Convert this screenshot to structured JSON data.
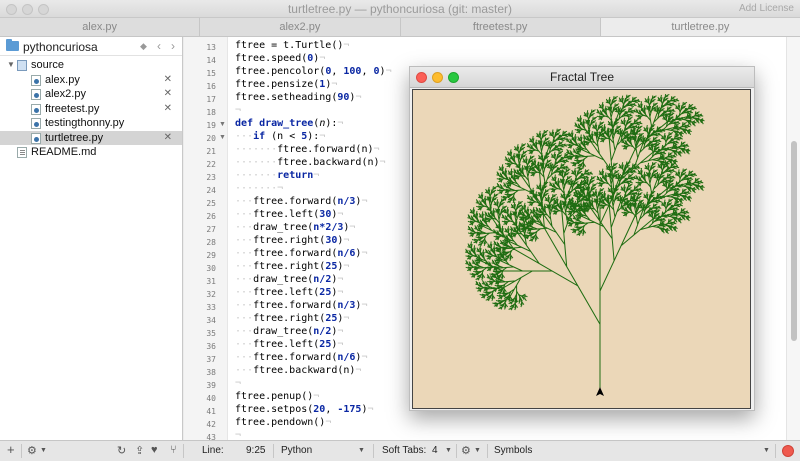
{
  "window": {
    "title": "turtletree.py — pythoncuriosa (git: master)",
    "add_license": "Add License"
  },
  "tabs": [
    {
      "label": "alex.py"
    },
    {
      "label": "alex2.py"
    },
    {
      "label": "ftreetest.py"
    },
    {
      "label": "turtletree.py"
    }
  ],
  "sidebar": {
    "project": "pythoncuriosa",
    "items": [
      {
        "label": "source"
      },
      {
        "label": "alex.py"
      },
      {
        "label": "alex2.py"
      },
      {
        "label": "ftreetest.py"
      },
      {
        "label": "testingthonny.py"
      },
      {
        "label": "turtletree.py"
      },
      {
        "label": "README.md"
      }
    ]
  },
  "editor": {
    "line_numbers": [
      "13",
      "14",
      "15",
      "16",
      "17",
      "18",
      "19",
      "20",
      "21",
      "22",
      "23",
      "24",
      "25",
      "26",
      "27",
      "28",
      "29",
      "30",
      "31",
      "32",
      "33",
      "34",
      "35",
      "36",
      "37",
      "38",
      "39",
      "40",
      "41",
      "42",
      "43",
      "44"
    ]
  },
  "turtle_window": {
    "title": "Fractal Tree"
  },
  "statusbar": {
    "line_label": "Line:",
    "position": "9:25",
    "language": "Python",
    "soft_tabs_label": "Soft Tabs:",
    "soft_tabs_value": "4",
    "symbols": "Symbols"
  },
  "colors": {
    "tree": "#1f6d12",
    "canvas": "#ebd7b8",
    "keyword": "#0a27a3"
  }
}
